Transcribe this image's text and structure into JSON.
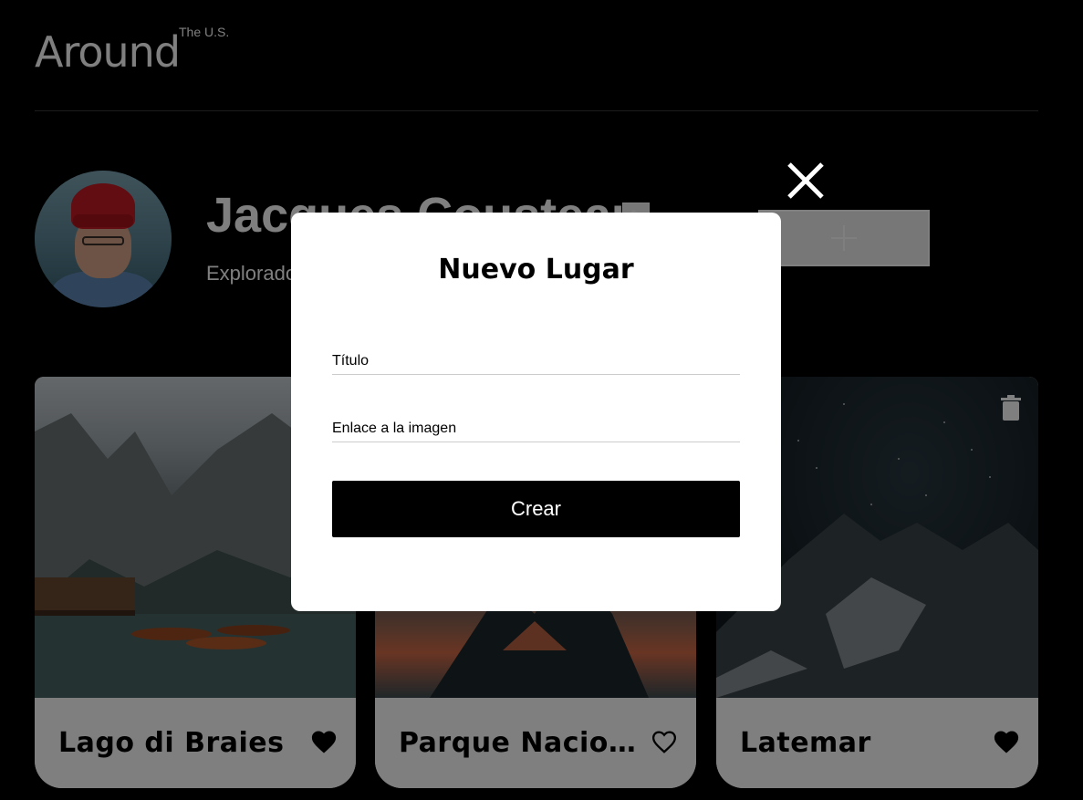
{
  "header": {
    "logo_main": "Around",
    "logo_sup": "The U.S."
  },
  "profile": {
    "name": "Jacques Cousteau",
    "about": "Explorador",
    "edit_icon": "pencil-icon",
    "add_icon": "plus-icon"
  },
  "cards": [
    {
      "title": "Lago di Braies",
      "liked": true,
      "like_icon": "heart-filled-icon"
    },
    {
      "title": "Parque Nacional de la Vanoise",
      "liked": false,
      "like_icon": "heart-outline-icon"
    },
    {
      "title": "Latemar",
      "liked": true,
      "like_icon": "heart-filled-icon",
      "delete_icon": "trash-icon"
    }
  ],
  "popup": {
    "title": "Nuevo Lugar",
    "fields": {
      "name_placeholder": "Título",
      "name_value": "",
      "link_placeholder": "Enlace a la imagen",
      "link_value": ""
    },
    "submit_label": "Crear",
    "close_icon": "close-icon"
  },
  "colors": {
    "background": "#000000",
    "overlay": "rgba(0,0,0,0.5)",
    "popup": "#ffffff",
    "button": "#000000"
  }
}
